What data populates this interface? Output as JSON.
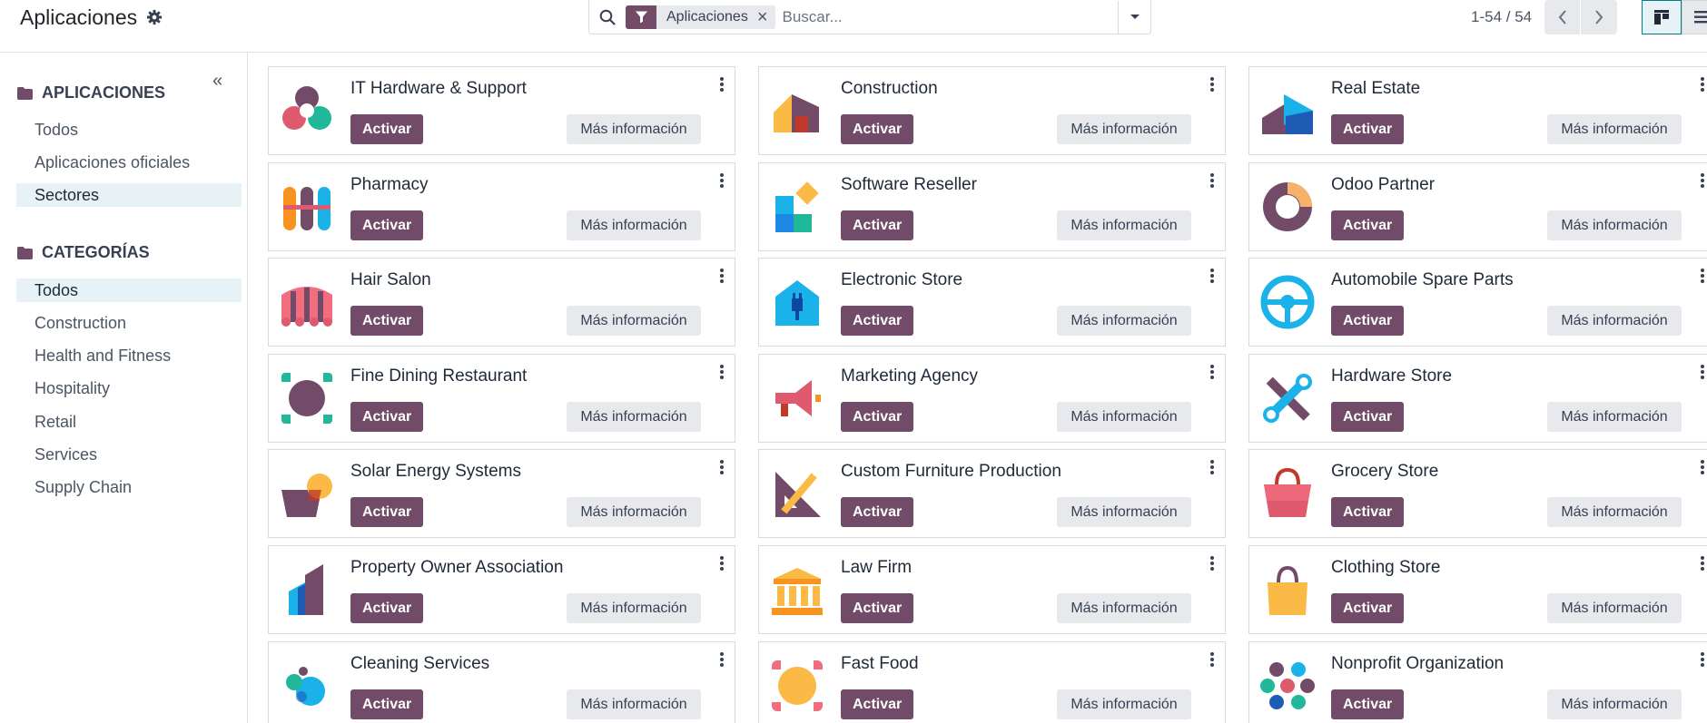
{
  "breadcrumb": {
    "title": "Aplicaciones"
  },
  "search": {
    "facet_label": "Aplicaciones",
    "placeholder": "Buscar..."
  },
  "pager": {
    "value": "1-54 / 54"
  },
  "sidebar": {
    "apps_heading": "APLICACIONES",
    "apps_items": [
      {
        "label": "Todos",
        "selected": false
      },
      {
        "label": "Aplicaciones oficiales",
        "selected": false
      },
      {
        "label": "Sectores",
        "selected": true
      }
    ],
    "cat_heading": "CATEGORÍAS",
    "cat_items": [
      {
        "label": "Todos",
        "selected": true
      },
      {
        "label": "Construction",
        "selected": false
      },
      {
        "label": "Health and Fitness",
        "selected": false
      },
      {
        "label": "Hospitality",
        "selected": false
      },
      {
        "label": "Retail",
        "selected": false
      },
      {
        "label": "Services",
        "selected": false
      },
      {
        "label": "Supply Chain",
        "selected": false
      }
    ]
  },
  "card_labels": {
    "activate": "Activar",
    "more_info": "Más información"
  },
  "cards": [
    {
      "name": "IT Hardware & Support",
      "icon": "it-hardware-icon"
    },
    {
      "name": "Construction",
      "icon": "construction-icon"
    },
    {
      "name": "Real Estate",
      "icon": "real-estate-icon"
    },
    {
      "name": "Pharmacy",
      "icon": "pharmacy-icon"
    },
    {
      "name": "Software Reseller",
      "icon": "software-reseller-icon"
    },
    {
      "name": "Odoo Partner",
      "icon": "odoo-partner-icon"
    },
    {
      "name": "Hair Salon",
      "icon": "hair-salon-icon"
    },
    {
      "name": "Electronic Store",
      "icon": "electronic-store-icon"
    },
    {
      "name": "Automobile Spare Parts",
      "icon": "steering-wheel-icon"
    },
    {
      "name": "Fine Dining Restaurant",
      "icon": "fine-dining-icon"
    },
    {
      "name": "Marketing Agency",
      "icon": "megaphone-icon"
    },
    {
      "name": "Hardware Store",
      "icon": "tools-icon"
    },
    {
      "name": "Solar Energy Systems",
      "icon": "solar-energy-icon"
    },
    {
      "name": "Custom Furniture Production",
      "icon": "set-square-icon"
    },
    {
      "name": "Grocery Store",
      "icon": "grocery-bag-icon"
    },
    {
      "name": "Property Owner Association",
      "icon": "property-icon"
    },
    {
      "name": "Law Firm",
      "icon": "courthouse-icon"
    },
    {
      "name": "Clothing Store",
      "icon": "shopping-bag-icon"
    },
    {
      "name": "Cleaning Services",
      "icon": "bubbles-icon"
    },
    {
      "name": "Fast Food",
      "icon": "fast-food-icon"
    },
    {
      "name": "Nonprofit Organization",
      "icon": "nonprofit-icon"
    }
  ],
  "colors": {
    "brand": "#714b67",
    "selected_bg": "#e6f2f5",
    "secondary_btn": "#e7e9ed"
  }
}
